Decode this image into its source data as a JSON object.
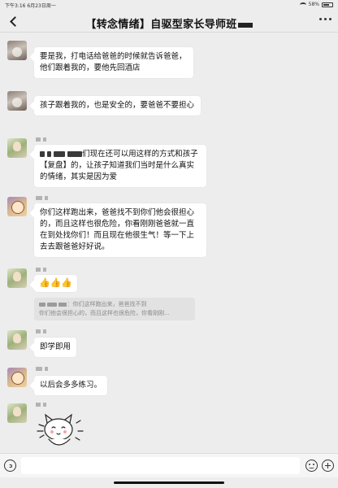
{
  "status_bar": {
    "time_date": "下午3:16  6月23日周一",
    "battery": "58%"
  },
  "header": {
    "title": "【转念情绪】自驱型家长导师班"
  },
  "messages": [
    {
      "type": "text",
      "avatar": "cup",
      "text": "要是我，打电话给爸爸的时候就告诉爸爸，他们跟着我的，要他先回酒店"
    },
    {
      "type": "text",
      "avatar": "cup",
      "text": "孩子跟着我的，也是安全的，要爸爸不要担心"
    },
    {
      "type": "text",
      "avatar": "green",
      "text_a": "们现在还可以用这样的方式和孩子【复盘】的，让孩子知道我们当时是什么真实的情绪，其实是因为爱"
    },
    {
      "type": "text",
      "avatar": "cartoon",
      "text": "你们这样跑出来，爸爸找不到你们他会很担心的，而且这样也很危险，你看刚刚爸爸就一直在到处找你们！而且现在他很生气！等一下上去去跟爸爸好好说。"
    },
    {
      "type": "emoji",
      "avatar": "green",
      "text": "👍👍👍"
    },
    {
      "type": "quote",
      "text_a": "：你们这样跑出来，爸爸找不到",
      "text_b": "你们他会很担心的，而且这样也很危险，你看刚刚..."
    },
    {
      "type": "text",
      "avatar": "green",
      "text": "即学即用"
    },
    {
      "type": "text",
      "avatar": "cartoon",
      "text": "以后会多多练习。"
    },
    {
      "type": "sticker",
      "avatar": "green",
      "sticker": "cartoon-cat-sticker"
    }
  ],
  "input": {
    "placeholder": ""
  }
}
